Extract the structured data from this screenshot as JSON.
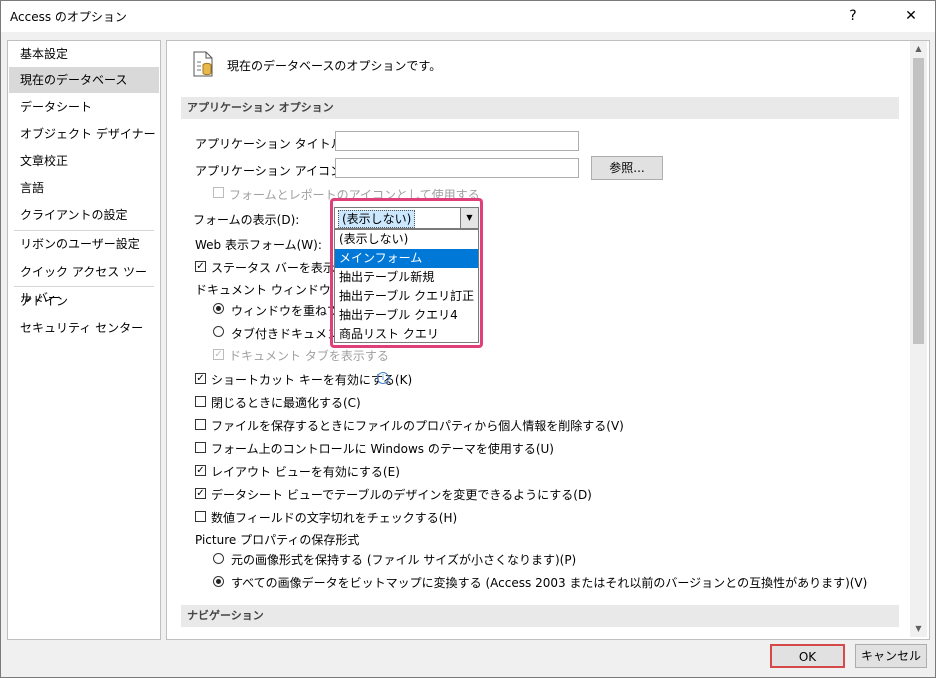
{
  "window": {
    "title": "Access のオプション",
    "help": "?",
    "close": "✕"
  },
  "sidebar": {
    "items": [
      {
        "label": "基本設定"
      },
      {
        "label": "現在のデータベース"
      },
      {
        "label": "データシート"
      },
      {
        "label": "オブジェクト デザイナー"
      },
      {
        "label": "文章校正"
      },
      {
        "label": "言語"
      },
      {
        "label": "クライアントの設定"
      },
      {
        "label": "リボンのユーザー設定"
      },
      {
        "label": "クイック アクセス ツール バー"
      },
      {
        "label": "アドイン"
      },
      {
        "label": "セキュリティ センター"
      }
    ],
    "selected_index": 1
  },
  "content": {
    "header": "現在のデータベースのオプションです。",
    "section_app": "アプリケーション オプション",
    "app_title_label": "アプリケーション タイトル(T):",
    "app_title_value": "",
    "app_icon_label": "アプリケーション アイコン(I):",
    "app_icon_value": "",
    "browse_button": "参照...",
    "use_icon_label": "フォームとレポートのアイコンとして使用する",
    "form_display_label": "フォームの表示(D):",
    "web_form_label": "Web 表示フォーム(W):",
    "status_bar_label": "ステータス バーを表示する",
    "doc_window_label": "ドキュメント ウィンドウ オプション",
    "overlap_windows_label": "ウィンドウを重ねて表示",
    "tabbed_docs_label": "タブ付きドキュメント(B)",
    "doc_tabs_label": "ドキュメント タブを表示する",
    "shortcut_keys_label": "ショートカット キーを有効にする(K)",
    "compact_on_close_label": "閉じるときに最適化する(C)",
    "remove_personal_label": "ファイルを保存するときにファイルのプロパティから個人情報を削除する(V)",
    "windows_theme_label": "フォーム上のコントロールに Windows のテーマを使用する(U)",
    "layout_view_label": "レイアウト ビューを有効にする(E)",
    "datasheet_design_label": "データシート ビューでテーブルのデザインを変更できるようにする(D)",
    "numeric_truncation_label": "数値フィールドの文字切れをチェックする(H)",
    "picture_format_label": "Picture プロパティの保存形式",
    "keep_format_label": "元の画像形式を保持する (ファイル サイズが小さくなります)(P)",
    "convert_bitmap_label": "すべての画像データをビットマップに変換する (Access 2003 またはそれ以前のバージョンとの互換性があります)(V)",
    "section_nav": "ナビゲーション"
  },
  "dropdown": {
    "selected": "(表示しない)",
    "options": [
      "(表示しない)",
      "メインフォーム",
      "抽出テーブル新規",
      "抽出テーブル クエリ訂正",
      "抽出テーブル クエリ4",
      "商品リスト クエリ"
    ],
    "highlighted_index": 1
  },
  "footer": {
    "ok": "OK",
    "cancel": "キャンセル"
  },
  "colors": {
    "accent": "#0078d7",
    "highlight_border": "#e0407a",
    "ok_border": "#d5494a"
  }
}
